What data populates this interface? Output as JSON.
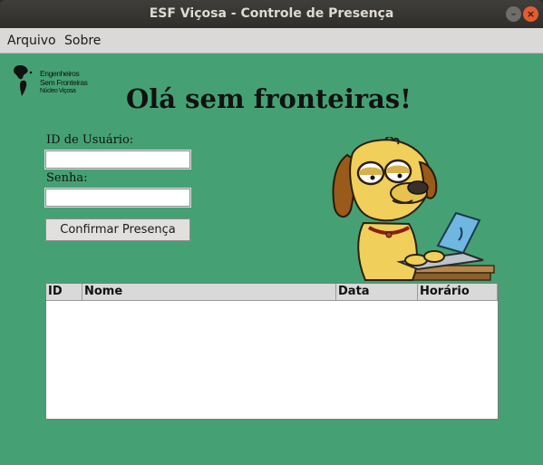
{
  "window": {
    "title": "ESF Viçosa - Controle de Presença",
    "minimize_glyph": "–",
    "close_glyph": "×"
  },
  "menu": {
    "items": [
      "Arquivo",
      "Sobre"
    ]
  },
  "logo": {
    "line1": "Engenheiros",
    "line2": "Sem Fronteiras",
    "line3": "Núcleo Viçosa"
  },
  "heading": "Olá sem fronteiras!",
  "form": {
    "user_label": "ID de Usuário:",
    "user_value": "",
    "password_label": "Senha:",
    "password_value": "",
    "confirm_label": "Confirmar Presença"
  },
  "table": {
    "columns": [
      "ID",
      "Nome",
      "Data",
      "Horário"
    ],
    "rows": []
  },
  "colors": {
    "background": "#45a174",
    "titlebar": "#3a3935",
    "close_button": "#e25d2f"
  }
}
